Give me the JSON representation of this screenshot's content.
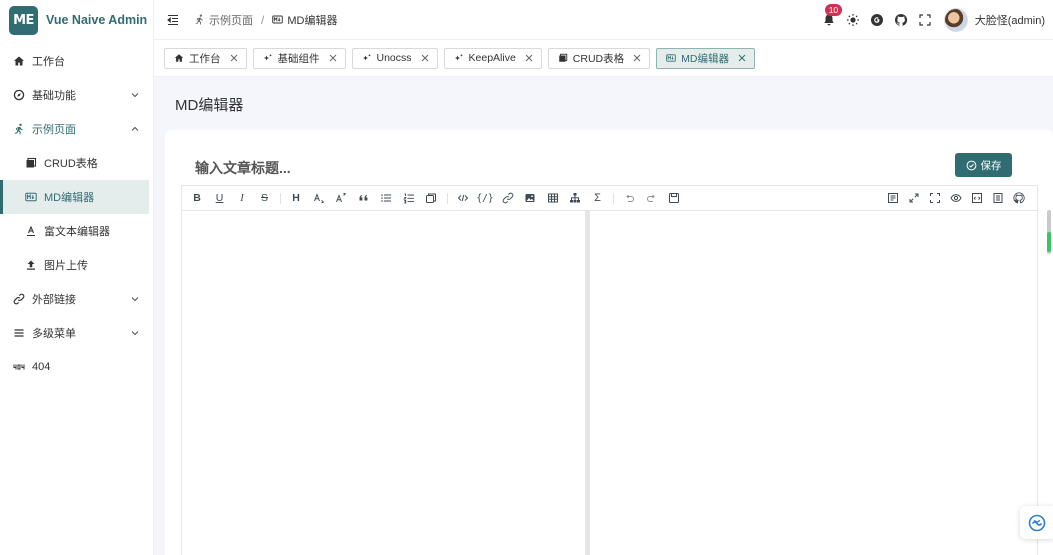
{
  "brand": {
    "logo_text": "ME",
    "name": "Vue Naive Admin",
    "accent": "#316c72"
  },
  "sidebar": {
    "items": [
      {
        "label": "工作台",
        "icon": "home-icon"
      },
      {
        "label": "基础功能",
        "icon": "compass-icon"
      },
      {
        "label": "示例页面",
        "icon": "run-icon"
      },
      {
        "label": "CRUD表格",
        "icon": "table-icon"
      },
      {
        "label": "MD编辑器",
        "icon": "markdown-icon"
      },
      {
        "label": "富文本编辑器",
        "icon": "text-editor-icon"
      },
      {
        "label": "图片上传",
        "icon": "upload-icon"
      },
      {
        "label": "外部链接",
        "icon": "link-icon"
      },
      {
        "label": "多级菜单",
        "icon": "menu-icon"
      },
      {
        "label": "404",
        "icon": "error-404-icon"
      }
    ]
  },
  "header": {
    "breadcrumb": {
      "parent": "示例页面",
      "separator": "/",
      "current": "MD编辑器"
    },
    "notification_count": "10",
    "user_name": "大脸怪(admin)"
  },
  "tabs": [
    {
      "label": "工作台"
    },
    {
      "label": "基础组件"
    },
    {
      "label": "Unocss"
    },
    {
      "label": "KeepAlive"
    },
    {
      "label": "CRUD表格"
    },
    {
      "label": "MD编辑器"
    }
  ],
  "main": {
    "page_title": "MD编辑器",
    "title_placeholder": "输入文章标题...",
    "save_label": "保存"
  }
}
